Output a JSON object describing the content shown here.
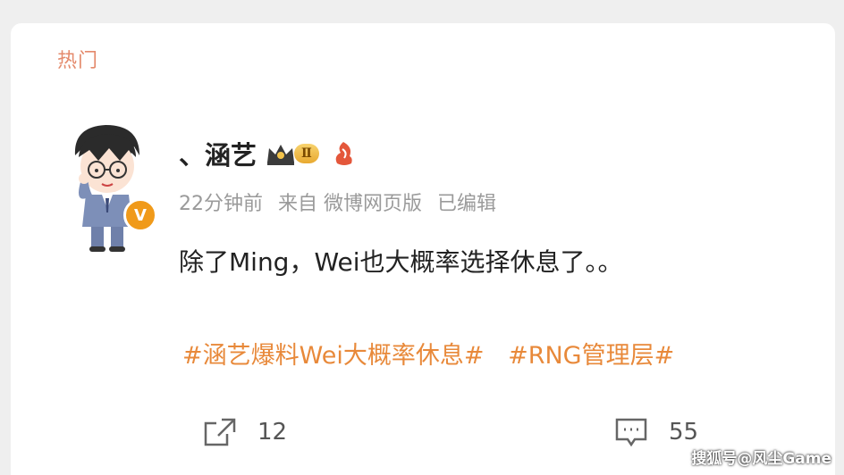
{
  "section": {
    "label": "热门"
  },
  "post": {
    "username": "、涵艺",
    "level": "Ⅱ",
    "verified_badge": "V",
    "meta": {
      "time": "22分钟前",
      "source": "来自 微博网页版",
      "edited": "已编辑"
    },
    "text": "除了Ming，Wei也大概率选择休息了。。",
    "hashtags": [
      "#涵艺爆料Wei大概率休息#",
      "#RNG管理层#"
    ]
  },
  "actions": {
    "share_count": "12",
    "comment_count": "55"
  },
  "watermark": "搜狐号@风尘Game",
  "colors": {
    "accent": "#e8893a",
    "section_label": "#e48a6c",
    "meta": "#9a9a9a"
  },
  "icons": {
    "share": "share-icon",
    "comment": "comment-icon",
    "crown": "crown-icon",
    "fan": "fan-icon"
  }
}
